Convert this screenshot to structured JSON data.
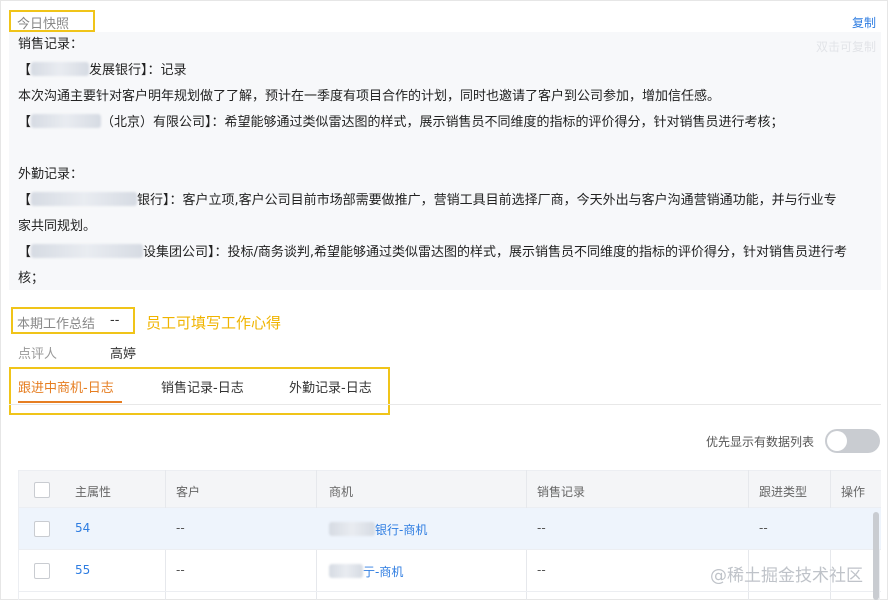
{
  "snapshot": {
    "title": "今日快照",
    "copy_label": "复制",
    "hint": "双击可复制",
    "lines": [
      "销售记录：",
      "发展银行】：记录",
      "本次沟通主要针对客户明年规划做了了解，预计在一季度有项目合作的计划，同时也邀请了客户到公司参加，增加信任感。",
      "（北京）有限公司】：希望能够通过类似雷达图的样式，展示销售员不同维度的指标的评价得分，针对销售员进行考核；",
      "外勤记录：",
      "银行】：客户立项,客户公司目前市场部需要做推广，营销工具目前选择厂商，今天外出与客户沟通营销通功能，并与行业专",
      "家共同规划。",
      "设集团公司】：投标/商务谈判,希望能够通过类似雷达图的样式，展示销售员不同维度的指标的评价得分，针对销售员进行考",
      "核；"
    ]
  },
  "summary": {
    "label": "本期工作总结",
    "value": "--",
    "annotation": "员工可填写工作心得"
  },
  "reviewer": {
    "label": "点评人",
    "value": "高婷"
  },
  "tabs": [
    {
      "label": "跟进中商机-日志",
      "active": true
    },
    {
      "label": "销售记录-日志",
      "active": false
    },
    {
      "label": "外勤记录-日志",
      "active": false
    }
  ],
  "toggle": {
    "label": "优先显示有数据列表",
    "on": false
  },
  "table": {
    "headers": [
      "主属性",
      "客户",
      "商机",
      "销售记录",
      "跟进类型",
      "操作"
    ],
    "rows": [
      {
        "id": "54",
        "customer": "--",
        "opportunity": "银行-商机",
        "sales": "--",
        "type": "--",
        "op": ""
      },
      {
        "id": "55",
        "customer": "--",
        "opportunity": "亍-商机",
        "sales": "--",
        "type": "",
        "op": ""
      }
    ]
  },
  "watermark": "@稀土掘金技术社区",
  "colors": {
    "highlight_box": "#f0c419",
    "accent": "#e67e22",
    "link": "#2f7de1"
  }
}
